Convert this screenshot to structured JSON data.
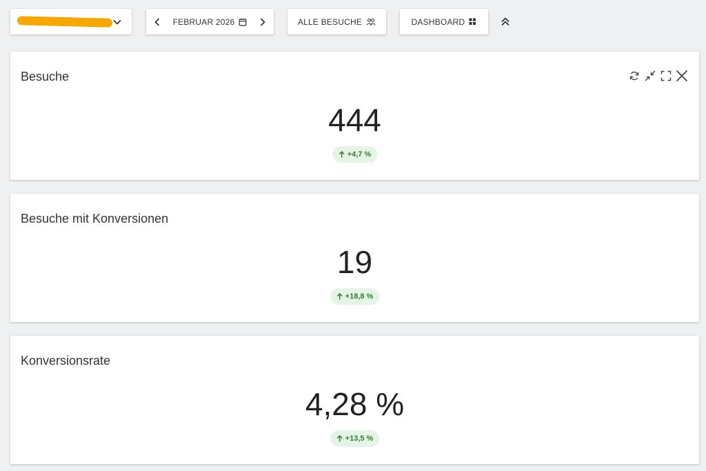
{
  "toolbar": {
    "site_selector": {
      "label": "",
      "icon": "chevron-down-icon",
      "mask_color": "#f7a800"
    },
    "date_nav": {
      "label": "FEBRUAR 2026",
      "prev_icon": "chevron-left-icon",
      "next_icon": "chevron-right-icon",
      "calendar_icon": "calendar-icon"
    },
    "segment": {
      "label": "ALLE BESUCHE",
      "icon": "users-icon"
    },
    "view": {
      "label": "DASHBOARD",
      "icon": "grid-icon"
    },
    "collapse_icon": "double-chevron-up-icon"
  },
  "widgets": [
    {
      "title": "Besuche",
      "value": "444",
      "trend": "+4,7 %",
      "trend_direction": "up"
    },
    {
      "title": "Besuche mit Konversionen",
      "value": "19",
      "trend": "+18,8 %",
      "trend_direction": "up"
    },
    {
      "title": "Konversionsrate",
      "value": "4,28 %",
      "trend": "+13,5 %",
      "trend_direction": "up"
    }
  ],
  "widget_actions": [
    "refresh-icon",
    "minimize-icon",
    "fullscreen-icon",
    "close-icon"
  ],
  "colors": {
    "background": "#eff0f2",
    "trend_bg": "#e6f4e6",
    "trend_fg": "#2e7d32"
  }
}
